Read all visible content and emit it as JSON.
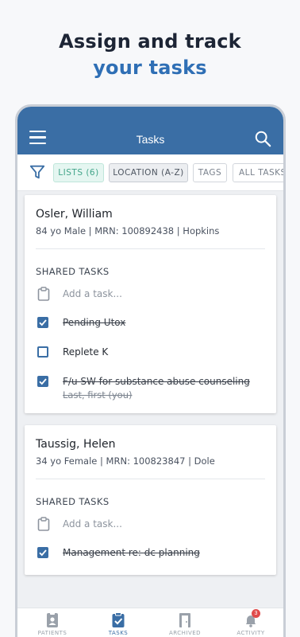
{
  "promo": {
    "line1": "Assign and track",
    "line2": "your tasks"
  },
  "appbar": {
    "title": "Tasks",
    "menu_icon": "hamburger-menu-icon",
    "search_icon": "search-icon",
    "color": "#3a6ea5"
  },
  "filters": {
    "icon": "filter-icon",
    "chips": [
      {
        "label": "LISTS (6)",
        "state": "active"
      },
      {
        "label": "LOCATION (A-Z)",
        "state": "selected"
      },
      {
        "label": "TAGS",
        "state": "default"
      },
      {
        "label": "ALL TASKS",
        "state": "default"
      }
    ]
  },
  "patients": [
    {
      "name": "Osler, William",
      "info": "84 yo Male | MRN: 100892438 | Hopkins",
      "section_title": "SHARED TASKS",
      "add_placeholder": "Add a task...",
      "tasks": [
        {
          "text": "Pending Utox",
          "checked": true
        },
        {
          "text": "Replete K",
          "checked": false
        },
        {
          "text": "F/u SW for substance abuse counseling",
          "checked": true,
          "assignee": "Last, first (you)"
        }
      ]
    },
    {
      "name": "Taussig, Helen",
      "info": "34 yo Female | MRN: 100823847 | Dole",
      "section_title": "SHARED TASKS",
      "add_placeholder": "Add a task...",
      "tasks": [
        {
          "text": "Management re: dc planning",
          "checked": true
        }
      ]
    }
  ],
  "bottom_nav": {
    "items": [
      {
        "label": "PATIENTS",
        "icon": "patient-badge-icon",
        "active": false
      },
      {
        "label": "TASKS",
        "icon": "task-clipboard-icon",
        "active": true
      },
      {
        "label": "ARCHIVED",
        "icon": "archive-door-icon",
        "active": false
      },
      {
        "label": "ACTIVITY",
        "icon": "bell-icon",
        "active": false,
        "badge": "3"
      }
    ]
  }
}
